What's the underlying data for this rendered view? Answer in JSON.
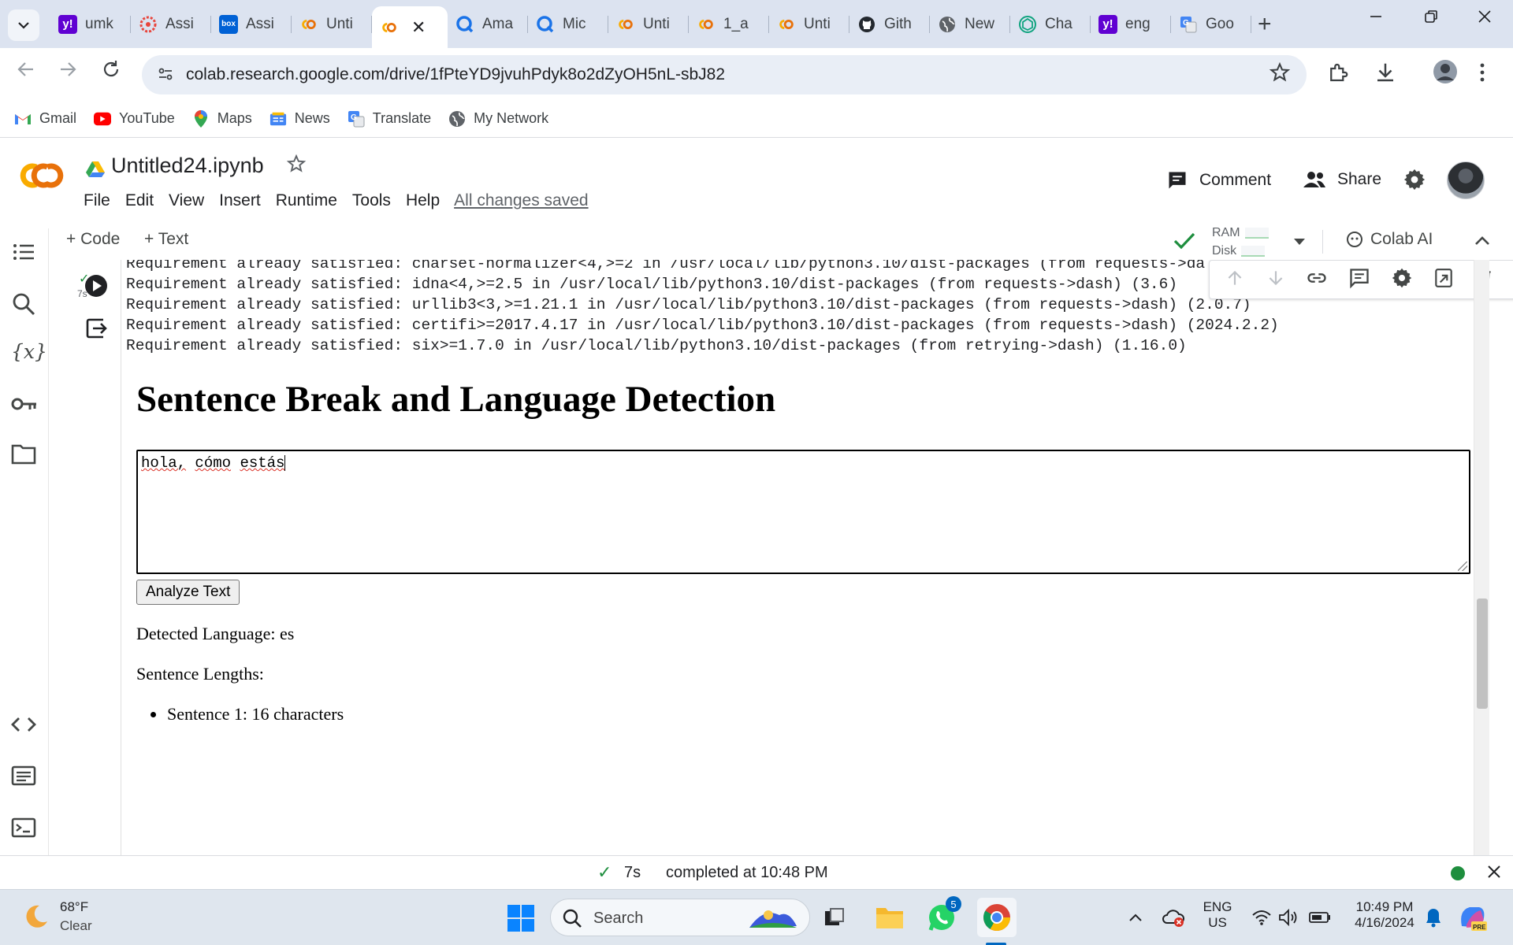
{
  "browser": {
    "tabs": [
      {
        "title": "umk",
        "icon": "yahoo-icon",
        "color": "#6001d2"
      },
      {
        "title": "Assi",
        "icon": "assistant-icon",
        "color": "#e8453c"
      },
      {
        "title": "Assi",
        "icon": "box-icon",
        "color": "#0061d5"
      },
      {
        "title": "Unti",
        "icon": "colab-icon",
        "color": "#f9ab00"
      },
      {
        "title": "",
        "icon": "colab-icon",
        "color": "#f9ab00",
        "active": true
      },
      {
        "title": "Ama",
        "icon": "quillbot-icon",
        "color": "#1a73e8"
      },
      {
        "title": "Mic",
        "icon": "quillbot-icon",
        "color": "#1a73e8"
      },
      {
        "title": "Unti",
        "icon": "colab-icon",
        "color": "#f9ab00"
      },
      {
        "title": "1_a",
        "icon": "colab-icon",
        "color": "#f9ab00"
      },
      {
        "title": "Unti",
        "icon": "colab-icon",
        "color": "#f9ab00"
      },
      {
        "title": "Gith",
        "icon": "github-icon",
        "color": "#24292f"
      },
      {
        "title": "New",
        "icon": "globe-icon",
        "color": "#5f6368"
      },
      {
        "title": "Cha",
        "icon": "chatgpt-icon",
        "color": "#10a37f"
      },
      {
        "title": "eng",
        "icon": "yahoo-icon",
        "color": "#6001d2"
      },
      {
        "title": "Goo",
        "icon": "translate-icon",
        "color": "#4285f4"
      }
    ],
    "tab_close": "✕",
    "new_tab": "+",
    "url": "colab.research.google.com/drive/1fPteYD9jvuhPdyk8o2dZyOH5nL-sbJ82",
    "bookmarks": [
      {
        "label": "Gmail",
        "icon": "gmail-icon"
      },
      {
        "label": "YouTube",
        "icon": "youtube-icon"
      },
      {
        "label": "Maps",
        "icon": "maps-icon"
      },
      {
        "label": "News",
        "icon": "news-icon"
      },
      {
        "label": "Translate",
        "icon": "translate-icon"
      },
      {
        "label": "My Network",
        "icon": "network-icon"
      }
    ]
  },
  "colab": {
    "logo": "CO",
    "notebook_title": "Untitled24.ipynb",
    "menu": [
      "File",
      "Edit",
      "View",
      "Insert",
      "Runtime",
      "Tools",
      "Help"
    ],
    "save_status": "All changes saved",
    "comment_label": "Comment",
    "share_label": "Share",
    "add_code": "+ Code",
    "add_text": "+ Text",
    "ram_label": "RAM",
    "disk_label": "Disk",
    "colab_ai_label": "Colab AI",
    "exec_time": "7s"
  },
  "cell": {
    "output_lines": [
      "Requirement already satisfied: charset-normalizer<4,>=2 in /usr/local/lib/python3.10/dist-packages (from requests->da",
      "Requirement already satisfied: idna<4,>=2.5 in /usr/local/lib/python3.10/dist-packages (from requests->dash) (3.6)",
      "Requirement already satisfied: urllib3<3,>=1.21.1 in /usr/local/lib/python3.10/dist-packages (from requests->dash) (2.0.7)",
      "Requirement already satisfied: certifi>=2017.4.17 in /usr/local/lib/python3.10/dist-packages (from requests->dash) (2024.2.2)",
      "Requirement already satisfied: six>=1.7.0 in /usr/local/lib/python3.10/dist-packages (from retrying->dash) (1.16.0)"
    ]
  },
  "dash_app": {
    "heading": "Sentence Break and Language Detection",
    "textarea_words": [
      "hola,",
      "cómo",
      "estás"
    ],
    "button_label": "Analyze Text",
    "detected_language": "Detected Language: es",
    "sentence_lengths_label": "Sentence Lengths:",
    "sentences": [
      "Sentence 1: 16 characters"
    ]
  },
  "statusbar": {
    "check": "✓",
    "time": "7s",
    "message": "completed at 10:48 PM"
  },
  "taskbar": {
    "temperature": "68°F",
    "weather": "Clear",
    "search_placeholder": "Search",
    "whatsapp_badge": "5",
    "lang_line1": "ENG",
    "lang_line2": "US",
    "clock_time": "10:49 PM",
    "clock_date": "4/16/2024"
  }
}
